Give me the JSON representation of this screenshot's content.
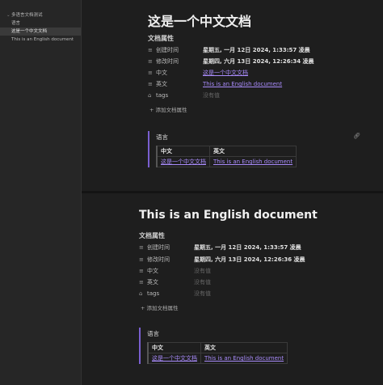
{
  "sidebar": {
    "items": [
      {
        "label": "多语言文档测试"
      },
      {
        "label": "语言"
      },
      {
        "label": "这是一个中文文档"
      },
      {
        "label": "This is an English document"
      }
    ]
  },
  "doc1": {
    "title": "这是一个中文文档",
    "props_heading": "文档属性",
    "props": [
      {
        "key": "创建时间",
        "value": "星期五, 一月 12日 2024, 1:33:57 凌晨"
      },
      {
        "key": "修改时间",
        "value": "星期四, 六月 13日 2024, 12:26:34 凌晨"
      },
      {
        "key": "中文",
        "value": "这是一个中文文档"
      },
      {
        "key": "英文",
        "value": "This is an English document"
      },
      {
        "key": "tags",
        "value": "没有值"
      }
    ],
    "add_prop": "添加文档属性",
    "callout_title": "语言",
    "table": {
      "headers": [
        "中文",
        "英文"
      ],
      "row": [
        "这是一个中文文档",
        "This is an English document"
      ]
    }
  },
  "doc2": {
    "title": "This is an English document",
    "props_heading": "文档属性",
    "props": [
      {
        "key": "创建时间",
        "value": "星期五, 一月 12日 2024, 1:33:57 凌晨"
      },
      {
        "key": "修改时间",
        "value": "星期四, 六月 13日 2024, 12:26:36 凌晨"
      },
      {
        "key": "中文",
        "value": "没有值"
      },
      {
        "key": "英文",
        "value": "没有值"
      },
      {
        "key": "tags",
        "value": "没有值"
      }
    ],
    "add_prop": "添加文档属性",
    "callout_title": "语言",
    "table": {
      "headers": [
        "中文",
        "英文"
      ],
      "row": [
        "这是一个中文文档",
        "This is an English document"
      ]
    }
  },
  "icons": {
    "text_prop": "text-lines-icon",
    "tags_prop": "tag-icon",
    "add": "plus-icon",
    "link": "link-icon",
    "caret": "chevron-down-icon"
  },
  "colors": {
    "background": "#1e1e1e",
    "sidebar": "#262626",
    "accent": "#a88bfa",
    "callout_border": "#7a5fd0"
  }
}
